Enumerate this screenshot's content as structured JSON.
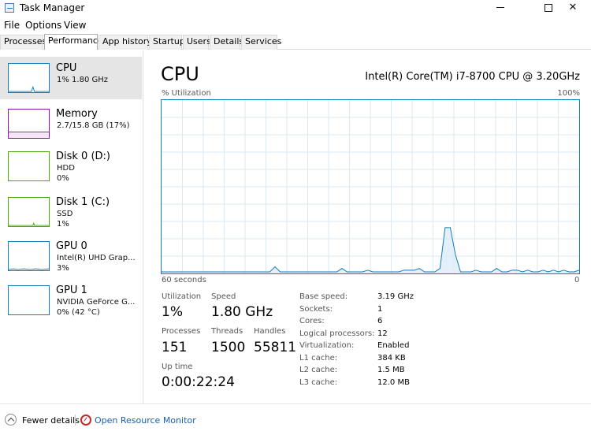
{
  "window": {
    "title": "Task Manager"
  },
  "menu": [
    "File",
    "Options",
    "View"
  ],
  "tabs": [
    "Processes",
    "Performance",
    "App history",
    "Startup",
    "Users",
    "Details",
    "Services"
  ],
  "sidebar": {
    "items": [
      {
        "name": "CPU",
        "line1": "1% 1.80 GHz",
        "line2": "",
        "color": "#117dbb"
      },
      {
        "name": "Memory",
        "line1": "2.7/15.8 GB (17%)",
        "line2": "",
        "color": "#8b12ae"
      },
      {
        "name": "Disk 0 (D:)",
        "line1": "HDD",
        "line2": "0%",
        "color": "#4da60c"
      },
      {
        "name": "Disk 1 (C:)",
        "line1": "SSD",
        "line2": "1%",
        "color": "#4da60c"
      },
      {
        "name": "GPU 0",
        "line1": "Intel(R) UHD Grap...",
        "line2": "3%",
        "color": "#117dbb"
      },
      {
        "name": "GPU 1",
        "line1": "NVIDIA GeForce G...",
        "line2": "0% (42 °C)",
        "color": "#117dbb"
      }
    ]
  },
  "main": {
    "title": "CPU",
    "model": "Intel(R) Core(TM) i7-8700 CPU @ 3.20GHz",
    "util_label": "% Utilization",
    "max_label": "100%",
    "time_left": "60 seconds",
    "time_right": "0",
    "graph_color": "#117dbb",
    "utilization_history": [
      0,
      0,
      0,
      0,
      0,
      0,
      0,
      0,
      0,
      0,
      0,
      0,
      0,
      0,
      0,
      0,
      0,
      0,
      0,
      0,
      0,
      0,
      3,
      0,
      0,
      0,
      0,
      0,
      0,
      0,
      0,
      0,
      0,
      0,
      0,
      2,
      0,
      0,
      0,
      0,
      1,
      0,
      0,
      0,
      0,
      0,
      0,
      1,
      1,
      1,
      2,
      0,
      0,
      0,
      2,
      26,
      26,
      10,
      0,
      0,
      0,
      1,
      0,
      0,
      0,
      2,
      0,
      0,
      1,
      1,
      0,
      1,
      0,
      0,
      1,
      0,
      1,
      0,
      1,
      0,
      0,
      1
    ]
  },
  "stats": {
    "utilization_label": "Utilization",
    "utilization": "1%",
    "speed_label": "Speed",
    "speed": "1.80 GHz",
    "processes_label": "Processes",
    "processes": "151",
    "threads_label": "Threads",
    "threads": "1500",
    "handles_label": "Handles",
    "handles": "55811",
    "uptime_label": "Up time",
    "uptime": "0:00:22:24"
  },
  "specs": [
    {
      "label": "Base speed:",
      "value": "3.19 GHz"
    },
    {
      "label": "Sockets:",
      "value": "1"
    },
    {
      "label": "Cores:",
      "value": "6"
    },
    {
      "label": "Logical processors:",
      "value": "12"
    },
    {
      "label": "Virtualization:",
      "value": "Enabled"
    },
    {
      "label": "L1 cache:",
      "value": "384 KB"
    },
    {
      "label": "L2 cache:",
      "value": "1.5 MB"
    },
    {
      "label": "L3 cache:",
      "value": "12.0 MB"
    }
  ],
  "footer": {
    "fewer_details": "Fewer details",
    "open_resource_monitor": "Open Resource Monitor"
  }
}
